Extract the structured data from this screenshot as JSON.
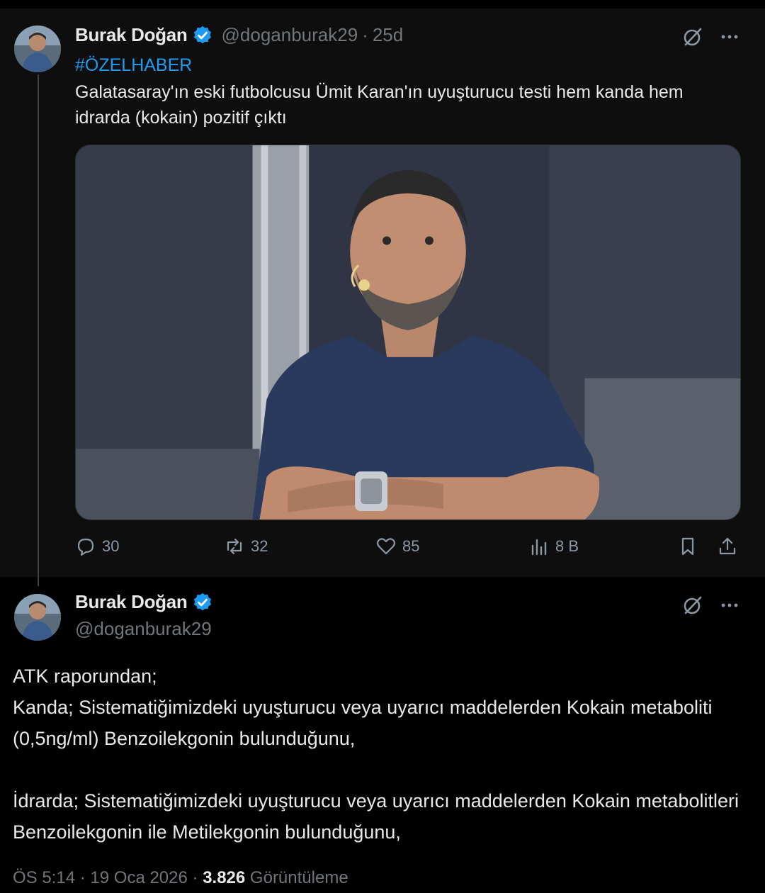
{
  "tweet1": {
    "author_name": "Burak Doğan",
    "handle": "@doganburak29",
    "separator": "·",
    "age": "25d",
    "hashtag": "#ÖZELHABER",
    "text": "Galatasaray'ın eski futbolcusu Ümit Karan'ın uyuşturucu testi hem kanda hem idrarda (kokain) pozitif çıktı",
    "actions": {
      "replies": "30",
      "reposts": "32",
      "likes": "85",
      "views": "8 B"
    }
  },
  "tweet2": {
    "author_name": "Burak Doğan",
    "handle": "@doganburak29",
    "paragraphs": [
      "ATK raporundan;",
      "Kanda; Sistematiğimizdeki uyuşturucu veya uyarıcı maddelerden Kokain metaboliti (0,5ng/ml) Benzoilekgonin bulunduğunu,",
      "İdrarda; Sistematiğimizdeki uyuşturucu veya uyarıcı maddelerden Kokain metabolitleri Benzoilekgonin ile Metilekgonin bulunduğunu,"
    ],
    "time": "ÖS 5:14",
    "separator": "·",
    "date": "19 Oca 2026",
    "views_count": "3.826",
    "views_label": "Görüntüleme"
  },
  "icons": {
    "verified": "verified-badge-icon",
    "grok": "grok-icon",
    "more": "more-icon",
    "reply": "reply-icon",
    "repost": "repost-icon",
    "like": "like-icon",
    "views": "views-icon",
    "bookmark": "bookmark-icon",
    "share": "share-icon"
  },
  "colors": {
    "background": "#000000",
    "text": "#e7e9ea",
    "secondary": "#71767b",
    "accent": "#1d9bf0"
  }
}
